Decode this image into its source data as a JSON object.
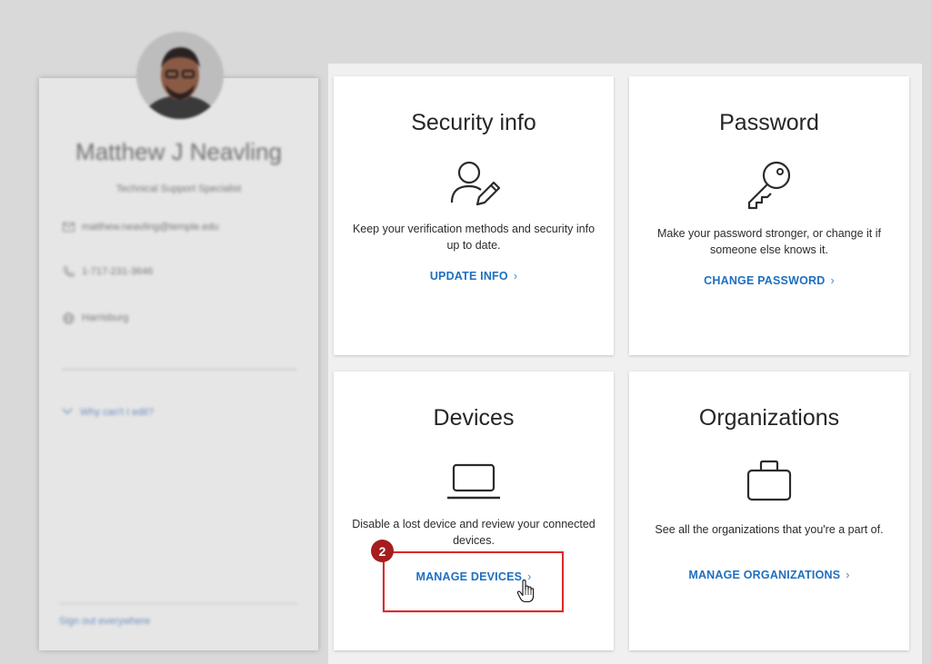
{
  "profile": {
    "name": "Matthew J Neavling",
    "role": "Technical Support Specialist",
    "email": "matthew.neavling@temple.edu",
    "phone": "1-717-231-3646",
    "location": "Harrisburg",
    "why_edit": "Why can't I edit?",
    "sign_out": "Sign out everywhere"
  },
  "tiles": [
    {
      "title": "Security info",
      "description": "Keep your verification methods and security info up to date.",
      "link": "UPDATE INFO",
      "icon": "user-edit-icon"
    },
    {
      "title": "Password",
      "description": "Make your password stronger, or change it if someone else knows it.",
      "link": "CHANGE PASSWORD",
      "icon": "key-icon"
    },
    {
      "title": "Devices",
      "description": "Disable a lost device and review your connected devices.",
      "link": "MANAGE DEVICES",
      "icon": "laptop-icon"
    },
    {
      "title": "Organizations",
      "description": "See all the organizations that you're a part of.",
      "link": "MANAGE ORGANIZATIONS",
      "icon": "briefcase-icon"
    }
  ],
  "annotation": {
    "step": "2",
    "color": "#d9292a"
  },
  "colors": {
    "link": "#1f6fbf",
    "badge": "#a51d1d"
  }
}
